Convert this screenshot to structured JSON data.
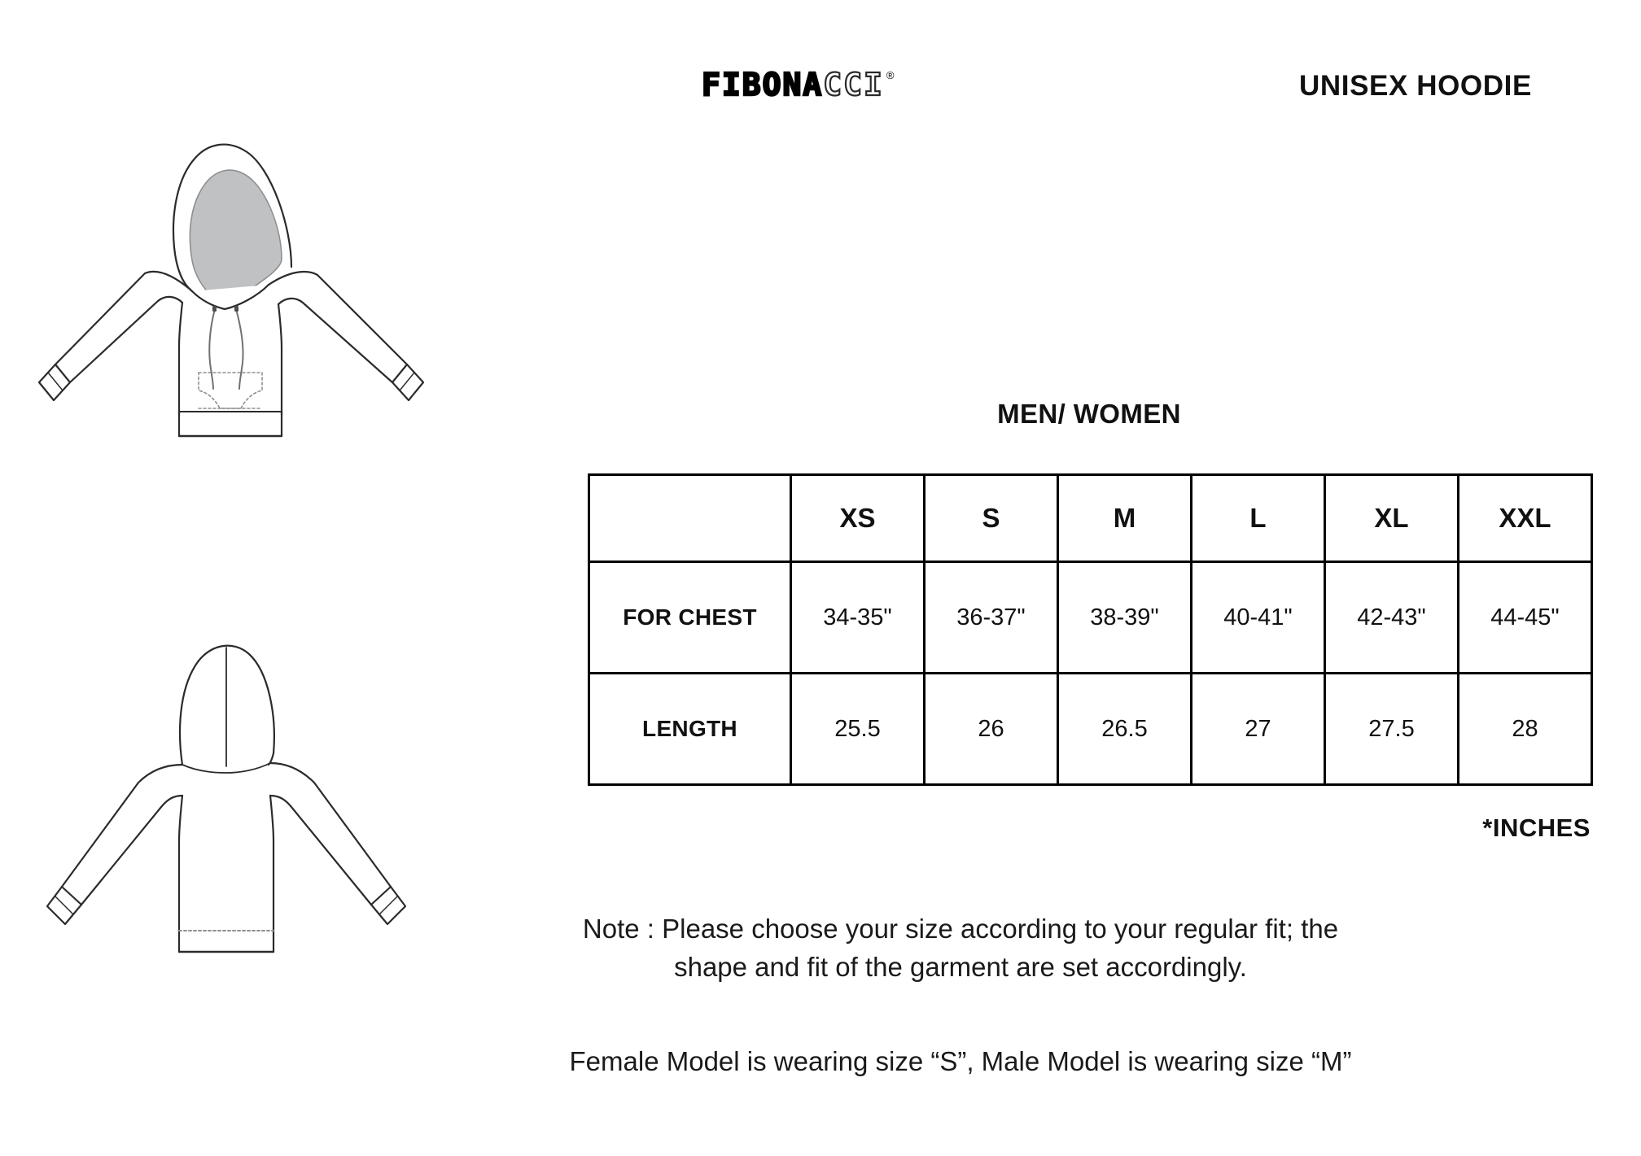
{
  "brand": {
    "name_solid": "FIBONA",
    "name_hollow": "CCI",
    "registered_mark": "®"
  },
  "header": {
    "product_title": "UNISEX HOODIE"
  },
  "size_chart": {
    "heading": "MEN/ WOMEN",
    "unit_note": "*INCHES",
    "corner_label": "",
    "columns": [
      "XS",
      "S",
      "M",
      "L",
      "XL",
      "XXL"
    ],
    "rows": [
      {
        "label": "FOR CHEST",
        "values": [
          "34-35\"",
          "36-37\"",
          "38-39\"",
          "40-41\"",
          "42-43\"",
          "44-45\""
        ]
      },
      {
        "label": "LENGTH",
        "values": [
          "25.5",
          "26",
          "26.5",
          "27",
          "27.5",
          "28"
        ]
      }
    ]
  },
  "notes": {
    "line1": "Note : Please choose your size according to your regular fit; the",
    "line2": "shape and fit of the garment are set accordingly.",
    "model_note": "Female Model is wearing size “S”, Male Model is wearing size “M”"
  },
  "illustrations": {
    "front_label": "hoodie-front-view",
    "back_label": "hoodie-back-view",
    "hood_lining_color": "#bfc1c2",
    "outline_color": "#2b2b2b"
  },
  "chart_data": {
    "type": "table",
    "title": "MEN/ WOMEN",
    "unit": "inches",
    "categories": [
      "XS",
      "S",
      "M",
      "L",
      "XL",
      "XXL"
    ],
    "series": [
      {
        "name": "FOR CHEST",
        "values": [
          "34-35\"",
          "36-37\"",
          "38-39\"",
          "40-41\"",
          "42-43\"",
          "44-45\""
        ]
      },
      {
        "name": "LENGTH",
        "values": [
          "25.5",
          "26",
          "26.5",
          "27",
          "27.5",
          "28"
        ]
      }
    ]
  }
}
